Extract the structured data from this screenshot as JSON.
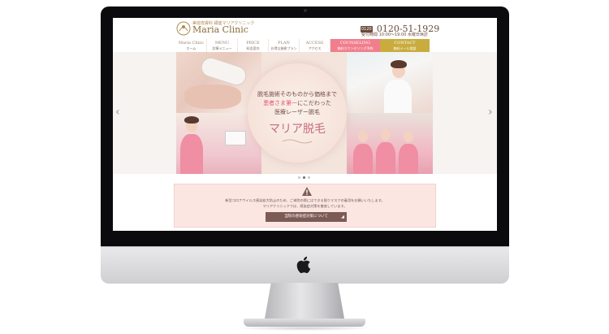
{
  "site": {
    "logo_tagline": "美容皮膚科 銀座マリアクリニック",
    "logo_name": "Maria Clinic",
    "phone_badge": "0120",
    "phone": "0120-51-1929",
    "hours": "受付時間 10:00～19:00 水曜日休診"
  },
  "nav": {
    "items": [
      {
        "en": "Maria Clinic",
        "jp": "ホーム"
      },
      {
        "en": "MENU",
        "jp": "診療メニュー"
      },
      {
        "en": "PRICE",
        "jp": "料金案内"
      },
      {
        "en": "PLAN",
        "jp": "お得な施術プラン"
      },
      {
        "en": "ACCESS",
        "jp": "アクセス"
      }
    ],
    "counseling": {
      "en": "COUNSELING",
      "jp": "無料カウンセリング予約"
    },
    "contact": {
      "en": "CONTACT",
      "jp": "無料メール相談"
    }
  },
  "hero": {
    "line1": "脱毛施術そのものから価格まで",
    "line2_em": "患者さま第一",
    "line2_rest": "にこだわった",
    "line3": "医療レーザー脱毛",
    "title": "マリア脱毛",
    "prev": "‹",
    "next": "›",
    "slide_count": 3,
    "active_slide": 1
  },
  "notice": {
    "line1": "新型コロナウイルス感染拡大防止のため、ご来院の際にはできる限りマスクの着用をお願いいたします。",
    "line2": "マリアクリニックでは、感染症対策を徹底しています。",
    "button": "当院の感染症対策について"
  },
  "colors": {
    "accent_pink": "#f07e8d",
    "accent_gold": "#c9ac3d",
    "brand_brown": "#8a6b3b",
    "button_brown": "#7d5b55"
  }
}
